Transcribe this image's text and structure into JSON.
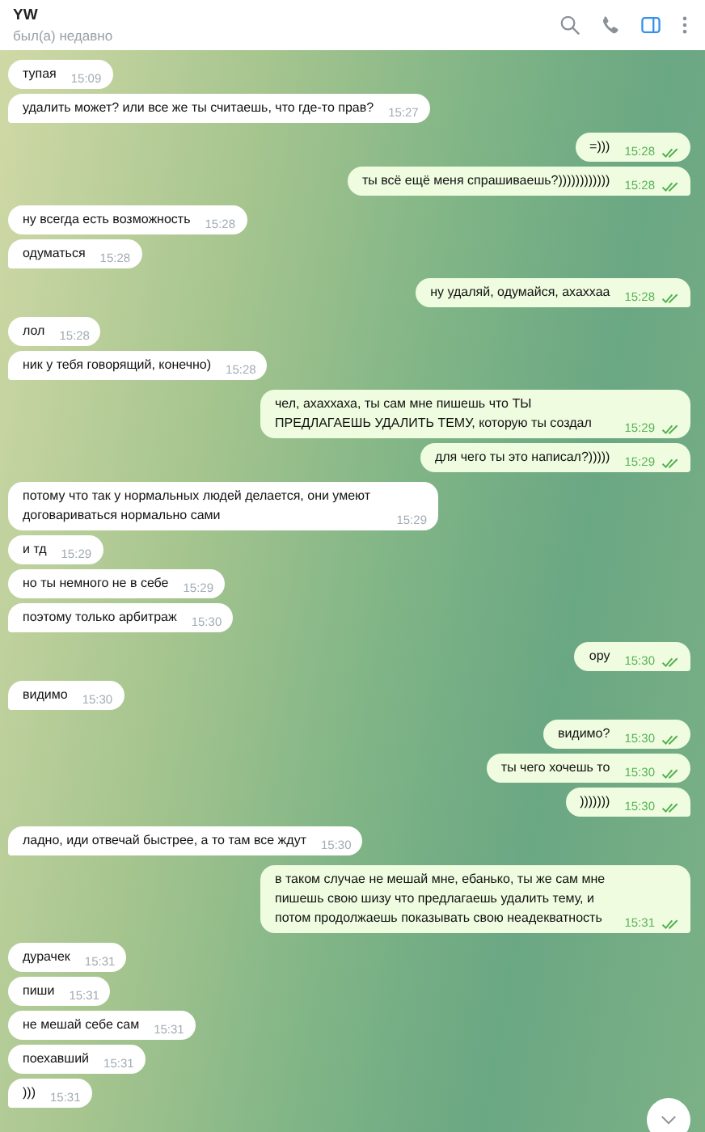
{
  "header": {
    "title": "YW",
    "status": "был(а) недавно",
    "sidebar_open": true
  },
  "groups": [
    {
      "kind": "incoming",
      "messages": [
        {
          "text": "тупая",
          "time": "15:09"
        },
        {
          "text": "удалить может? или все же ты считаешь, что где-то прав?",
          "time": "15:27"
        }
      ]
    },
    {
      "kind": "outgoing",
      "messages": [
        {
          "text": "=)))",
          "time": "15:28",
          "read": true
        },
        {
          "text": "ты всё ещё меня спрашиваешь?))))))))))))",
          "time": "15:28",
          "read": true
        }
      ]
    },
    {
      "kind": "incoming",
      "messages": [
        {
          "text": "ну всегда есть возможность",
          "time": "15:28"
        },
        {
          "text": "одуматься",
          "time": "15:28"
        }
      ]
    },
    {
      "kind": "outgoing",
      "messages": [
        {
          "text": "ну удаляй, одумайся, ахаххаа",
          "time": "15:28",
          "read": true
        }
      ]
    },
    {
      "kind": "incoming",
      "messages": [
        {
          "text": "лол",
          "time": "15:28"
        },
        {
          "text": "ник у тебя говорящий, конечно)",
          "time": "15:28"
        }
      ]
    },
    {
      "kind": "outgoing",
      "messages": [
        {
          "text": "чел, ахаххаха, ты сам мне пишешь что ТЫ ПРЕДЛАГАЕШЬ УДАЛИТЬ ТЕМУ,  которую ты создал",
          "time": "15:29",
          "read": true
        },
        {
          "text": "для чего ты это написал?)))))",
          "time": "15:29",
          "read": true
        }
      ]
    },
    {
      "kind": "incoming",
      "messages": [
        {
          "text": "потому что так у нормальных людей делается, они умеют договариваться нормально сами",
          "time": "15:29"
        },
        {
          "text": "и тд",
          "time": "15:29"
        },
        {
          "text": "но ты немного не в себе",
          "time": "15:29"
        },
        {
          "text": "поэтому только арбитраж",
          "time": "15:30"
        }
      ]
    },
    {
      "kind": "outgoing",
      "messages": [
        {
          "text": "ору",
          "time": "15:30",
          "read": true
        }
      ]
    },
    {
      "kind": "incoming",
      "messages": [
        {
          "text": "видимо",
          "time": "15:30"
        }
      ]
    },
    {
      "kind": "outgoing",
      "messages": [
        {
          "text": "видимо?",
          "time": "15:30",
          "read": true
        },
        {
          "text": "ты чего хочешь то",
          "time": "15:30",
          "read": true
        },
        {
          "text": ")))))))",
          "time": "15:30",
          "read": true
        }
      ]
    },
    {
      "kind": "incoming",
      "messages": [
        {
          "text": "ладно, иди отвечай быстрее, а то там все ждут",
          "time": "15:30"
        }
      ]
    },
    {
      "kind": "outgoing",
      "messages": [
        {
          "text": "в таком случае не мешай мне, ебанько, ты же сам мне пишешь свою шизу что предлагаешь удалить тему, и потом продолжаешь показывать свою неадекватность",
          "time": "15:31",
          "read": true
        }
      ]
    },
    {
      "kind": "incoming",
      "messages": [
        {
          "text": "дурачек",
          "time": "15:31"
        },
        {
          "text": "пиши",
          "time": "15:31"
        },
        {
          "text": "не мешай себе сам",
          "time": "15:31"
        },
        {
          "text": "поехавший",
          "time": "15:31"
        },
        {
          "text": ")))",
          "time": "15:31"
        }
      ]
    }
  ]
}
